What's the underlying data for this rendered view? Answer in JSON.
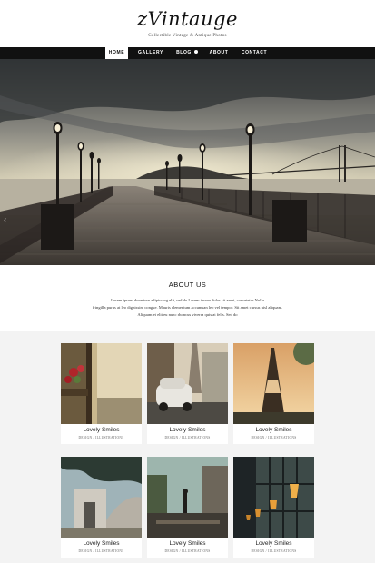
{
  "site": {
    "logo": "zVintauge",
    "tagline": "Collectible Vintage & Antique Photos"
  },
  "nav": {
    "items": [
      {
        "label": "HOME",
        "active": true
      },
      {
        "label": "GALLERY",
        "active": false
      },
      {
        "label": "BLOG",
        "active": false,
        "has_dropdown": true
      },
      {
        "label": "ABOUT",
        "active": false
      },
      {
        "label": "CONTACT",
        "active": false
      }
    ]
  },
  "hero": {
    "arrow_icon": "chevron-left-icon",
    "arrow_glyph": "‹"
  },
  "about": {
    "title": "ABOUT US",
    "lines": [
      "Lorem ipsum dosertore adipiscing elit, sed do Lorem ipsum dolor sit amet, consetetur Nulla",
      "fringilla purus at leo dignissim congue. Mauris elementum accumsan leo vel tempor. Sit amet cursus nisl aliquam.",
      "Aliquam et elit eu nunc rhoncus viverra quis at felis. Sed do"
    ]
  },
  "gallery": {
    "items": [
      {
        "title": "Lovely Smiles",
        "category": "DESIGN / ILLUSTRATIONS"
      },
      {
        "title": "Lovely Smiles",
        "category": "DESIGN / ILLUSTRATIONS"
      },
      {
        "title": "Lovely Smiles",
        "category": "DESIGN / ILLUSTRATIONS"
      },
      {
        "title": "Lovely Smiles",
        "category": "DESIGN / ILLUSTRATIONS"
      },
      {
        "title": "Lovely Smiles",
        "category": "DESIGN / ILLUSTRATIONS"
      },
      {
        "title": "Lovely Smiles",
        "category": "DESIGN / ILLUSTRATIONS"
      }
    ]
  },
  "colors": {
    "nav_bg": "#111111",
    "gallery_bg": "#f3f3f3"
  }
}
